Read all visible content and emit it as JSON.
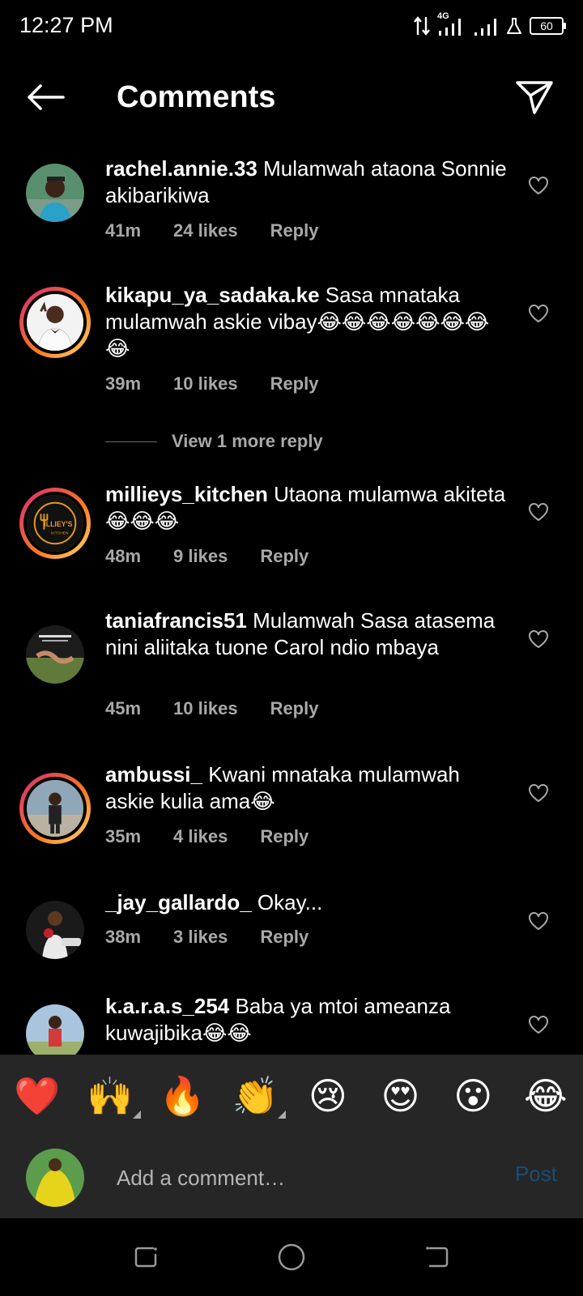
{
  "status_bar": {
    "time": "12:27 PM",
    "network": "4G",
    "battery": "60"
  },
  "header": {
    "title": "Comments"
  },
  "comments": [
    {
      "user": "rachel.annie.33",
      "text": "Mulamwah ataona Sonnie akibarikiwa",
      "time": "41m",
      "likes": "24 likes",
      "reply": "Reply"
    },
    {
      "user": "kikapu_ya_sadaka.ke",
      "text": "Sasa mnataka mulamwah askie vibay😂😂😂😂😂😂😂😂",
      "time": "39m",
      "likes": "10 likes",
      "reply": "Reply"
    },
    {
      "user": "millieys_kitchen",
      "text": "Utaona mulamwa akiteta😂😂😂",
      "time": "48m",
      "likes": "9 likes",
      "reply": "Reply"
    },
    {
      "user": "taniafrancis51",
      "text": "Mulamwah Sasa atasema nini aliitaka tuone Carol ndio mbaya",
      "time": "45m",
      "likes": "10 likes",
      "reply": "Reply"
    },
    {
      "user": "ambussi_",
      "text": "Kwani mnataka mulamwah askie kulia ama😂",
      "time": "35m",
      "likes": "4 likes",
      "reply": "Reply"
    },
    {
      "user": "_jay_gallardo_",
      "text": "Okay...",
      "time": "38m",
      "likes": "3 likes",
      "reply": "Reply"
    },
    {
      "user": "k.a.r.a.s_254",
      "text": "Baba ya mtoi ameanza kuwajibika😂😂"
    }
  ],
  "view_more": {
    "label": "View 1 more reply"
  },
  "avatar_labels": {
    "millieys": "ILLIEY'S",
    "millieys_sub": "KITCHEN"
  },
  "emoji_bar": [
    "❤️",
    "🙌",
    "🔥",
    "👏",
    "😢",
    "😍",
    "😮",
    "😂"
  ],
  "comment_input": {
    "placeholder": "Add a comment…",
    "post_label": "Post"
  },
  "colors": {
    "background": "#000000",
    "panel": "#262626",
    "muted": "#a8a8a8",
    "post_disabled": "#1c4b74",
    "story_ring_start": "#d62976",
    "story_ring_end": "#fa7e1e"
  }
}
